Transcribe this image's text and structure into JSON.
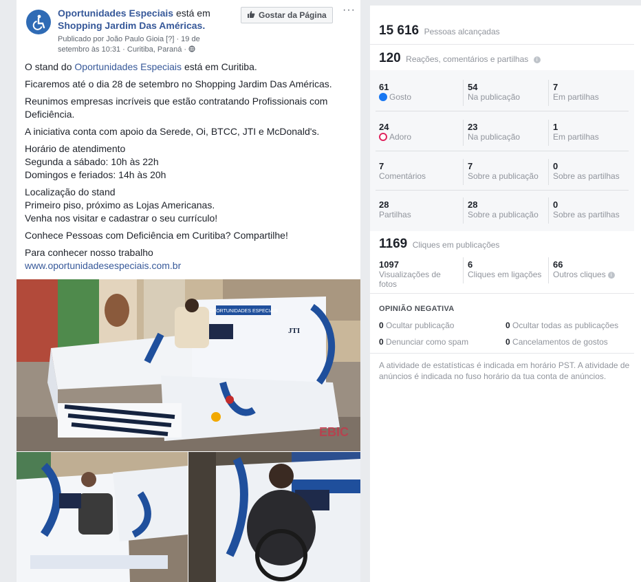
{
  "post": {
    "page_name": "Oportunidades Especiais",
    "is_at": "está em",
    "place": "Shopping Jardim Das Américas.",
    "meta": "Publicado por João Paulo Gioia [?] · 19 de setembro às 10:31 · Curitiba, Paraná ·",
    "like_page_label": "Gostar da Página",
    "more_label": "···",
    "body": {
      "p1_pre": "O stand do",
      "p1_link": "Oportunidades Especiais",
      "p1_post": "está em Curitiba.",
      "p2": "Ficaremos até o dia 28 de setembro no Shopping Jardim Das Américas.",
      "p3": "Reunimos empresas incríveis que estão contratando Profissionais com Deficiência.",
      "p4": "A iniciativa conta com apoio da Serede, Oi, BTCC, JTI e McDonald's.",
      "p5_l1": "Horário de atendimento",
      "p5_l2": "Segunda a sábado: 10h às 22h",
      "p5_l3": "Domingos e feriados: 14h às 20h",
      "p6_l1": "Localização do stand",
      "p6_l2": "Primeiro piso, próximo as Lojas Americanas.",
      "p6_l3": "Venha nos visitar e cadastrar o seu currículo!",
      "p7": "Conhece Pessoas com Deficiência em Curitiba? Compartilhe!",
      "p8_l1": "Para conhecer nosso trabalho",
      "p8_link": "www.oportunidadesespeciais.com.br"
    },
    "photo_sign": "OPORTUNIDADES ESPECIAIS",
    "photo_brand": "JTI"
  },
  "stats": {
    "reach_value": "15 616",
    "reach_label": "Pessoas alcançadas",
    "engagement_value": "120",
    "engagement_label": "Reações, comentários e partilhas",
    "rows": [
      {
        "c1_num": "61",
        "c1_lbl": "Gosto",
        "c2_num": "54",
        "c2_lbl": "Na publicação",
        "c3_num": "7",
        "c3_lbl": "Em partilhas"
      },
      {
        "c1_num": "24",
        "c1_lbl": "Adoro",
        "c2_num": "23",
        "c2_lbl": "Na publicação",
        "c3_num": "1",
        "c3_lbl": "Em partilhas"
      },
      {
        "c1_num": "7",
        "c1_lbl": "Comentários",
        "c2_num": "7",
        "c2_lbl": "Sobre a publicação",
        "c3_num": "0",
        "c3_lbl": "Sobre as partilhas"
      },
      {
        "c1_num": "28",
        "c1_lbl": "Partilhas",
        "c2_num": "28",
        "c2_lbl": "Sobre a publicação",
        "c3_num": "0",
        "c3_lbl": "Sobre as partilhas"
      }
    ],
    "clicks_value": "1169",
    "clicks_label": "Cliques em publicações",
    "clicks": [
      {
        "num": "1097",
        "lbl": "Visualizações de fotos"
      },
      {
        "num": "6",
        "lbl": "Cliques em ligações"
      },
      {
        "num": "66",
        "lbl": "Outros cliques"
      }
    ],
    "negative_title": "OPINIÃO NEGATIVA",
    "negative": [
      {
        "num": "0",
        "lbl": "Ocultar publicação"
      },
      {
        "num": "0",
        "lbl": "Ocultar todas as publicações"
      },
      {
        "num": "0",
        "lbl": "Denunciar como spam"
      },
      {
        "num": "0",
        "lbl": "Cancelamentos de gostos"
      }
    ],
    "footnote": "A atividade de estatísticas é indicada em horário PST. A atividade de anúncios é indicada no fuso horário da tua conta de anúncios."
  },
  "colors": {
    "link": "#365899",
    "like_blue": "#1877f2",
    "love_red": "#e0245e"
  }
}
